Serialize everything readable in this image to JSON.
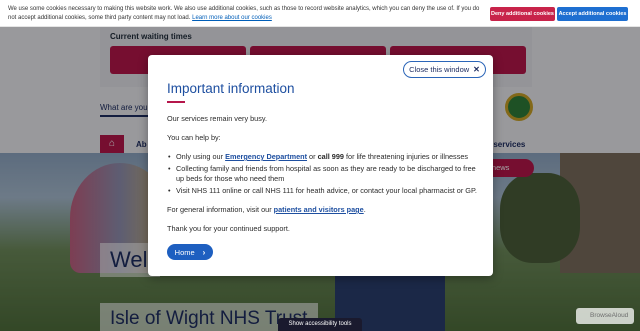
{
  "cookie_bar": {
    "text": "We use some cookies necessary to making this website work. We also use additional cookies, such as those to record website analytics, which you can deny the use of. If you do not accept additional cookies, some third party content may not load.",
    "learn_more": "Learn more about our cookies",
    "deny_label": "Deny additional cookies",
    "accept_label": "Accept additional cookies"
  },
  "page": {
    "waiting_title": "Current waiting times",
    "search_placeholder": "What are you",
    "nav_partial_left": "Ab",
    "nav_partial_right": "r services",
    "news_button": "st news",
    "welcome_partial": "Welc",
    "trust_name": "Isle of Wight NHS Trust",
    "accessibility_tools": "Show accessibility tools",
    "browsealoud": "BrowseAloud"
  },
  "modal": {
    "close_label": "Close this window",
    "close_icon": "close-x-icon",
    "title": "Important information",
    "intro": "Our services remain very busy.",
    "help_lead": "You can help by:",
    "bullet1_pre": "Only using our",
    "bullet1_link": "Emergency Department",
    "bullet1_mid": "or",
    "bullet1_bold": "call 999",
    "bullet1_post": "for life threatening injuries or illnesses",
    "bullet2": "Collecting family and friends from hospital as soon as they are ready to be discharged to free up beds for those who need them",
    "bullet3": "Visit NHS 111 online or call NHS 111 for heath advice, or contact your local pharmacist or GP.",
    "general_pre": "For general information, visit our",
    "general_link": "patients and visitors page",
    "general_post": ".",
    "thanks": "Thank you for your continued support.",
    "home_label": "Home"
  },
  "colors": {
    "brand_pink": "#b5164b",
    "brand_blue": "#1e5fc0",
    "title_blue": "#1e4fa0"
  }
}
